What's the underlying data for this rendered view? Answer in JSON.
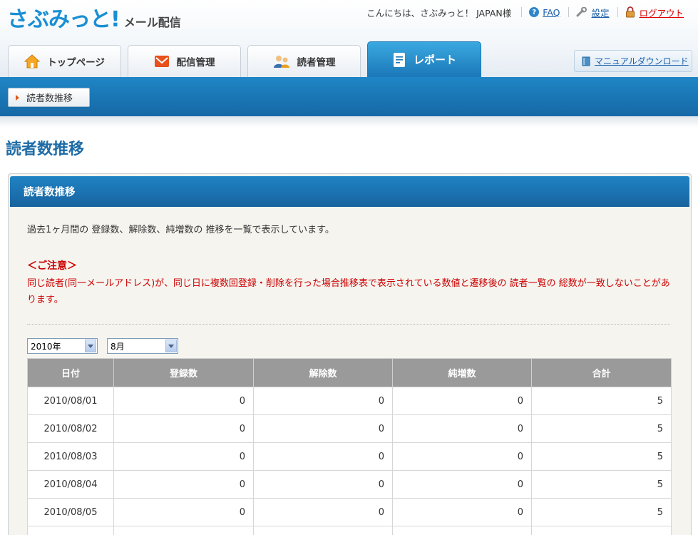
{
  "logo": {
    "main": "さぶみっと!",
    "sub": "メール配信"
  },
  "userbar": {
    "greeting": "こんにちは、さぶみっと！ JAPAN様",
    "faq": "FAQ",
    "settings": "設定",
    "logout": "ログアウト"
  },
  "tabs": [
    {
      "label": "トップページ",
      "icon": "home-icon"
    },
    {
      "label": "配信管理",
      "icon": "mail-icon"
    },
    {
      "label": "読者管理",
      "icon": "users-icon"
    },
    {
      "label": "レポート",
      "icon": "report-icon",
      "active": true
    }
  ],
  "manual": {
    "label": "マニュアルダウンロード",
    "icon": "book-icon"
  },
  "subnav": {
    "label": "読者数推移"
  },
  "page": {
    "title": "読者数推移"
  },
  "panel": {
    "title": "読者数推移",
    "description": "過去1ヶ月間の 登録数、解除数、純増数の 推移を一覧で表示しています。",
    "notice_title": "＜ご注意＞",
    "notice_body": "同じ読者(同一メールアドレス)が、同じ日に複数回登録・削除を行った場合推移表で表示されている数値と遷移後の 読者一覧の 総数が一致しないことがあります。"
  },
  "filters": {
    "year": "2010年",
    "month": "8月"
  },
  "table": {
    "headers": [
      "日付",
      "登録数",
      "解除数",
      "純増数",
      "合計"
    ],
    "rows": [
      [
        "2010/08/01",
        "0",
        "0",
        "0",
        "5"
      ],
      [
        "2010/08/02",
        "0",
        "0",
        "0",
        "5"
      ],
      [
        "2010/08/03",
        "0",
        "0",
        "0",
        "5"
      ],
      [
        "2010/08/04",
        "0",
        "0",
        "0",
        "5"
      ],
      [
        "2010/08/05",
        "0",
        "0",
        "0",
        "5"
      ]
    ]
  },
  "colors": {
    "brand": "#1a8fd4",
    "nav_blue": "#1b78b8",
    "title_blue": "#1d6ba6",
    "notice_red": "#cc0000",
    "table_header": "#9a9a9a"
  }
}
